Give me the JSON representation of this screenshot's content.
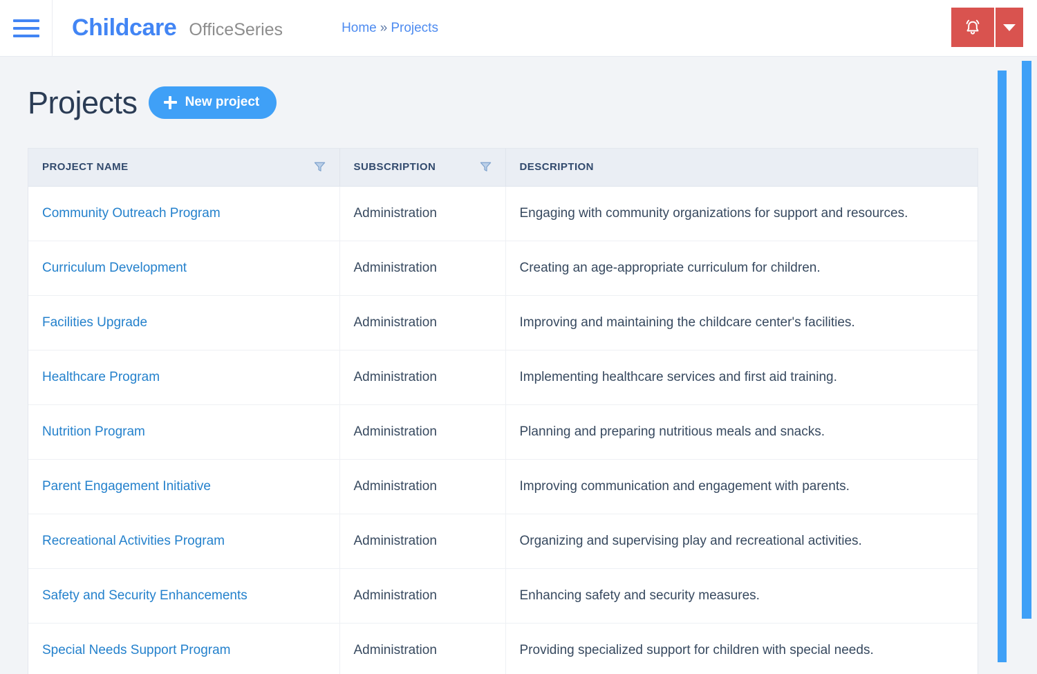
{
  "header": {
    "menu_icon": "hamburger-icon",
    "brand_main": "Childcare",
    "brand_sub": "OfficeSeries",
    "breadcrumb": {
      "home": "Home",
      "separator": "»",
      "current": "Projects"
    },
    "actions": {
      "bell_icon": "bell-icon",
      "caret_icon": "caret-down-icon",
      "accent_color": "#d9534f"
    }
  },
  "page": {
    "title": "Projects",
    "new_button_label": "New project",
    "new_button_icon": "plus-icon",
    "accent_color": "#3fa0f7"
  },
  "table": {
    "columns": [
      {
        "label": "PROJECT NAME",
        "filterable": true,
        "filter_icon": "filter-funnel-icon"
      },
      {
        "label": "SUBSCRIPTION",
        "filterable": true,
        "filter_icon": "filter-funnel-icon"
      },
      {
        "label": "DESCRIPTION",
        "filterable": false,
        "filter_icon": ""
      }
    ],
    "rows": [
      {
        "name": "Community Outreach Program",
        "subscription": "Administration",
        "description": "Engaging with community organizations for support and resources."
      },
      {
        "name": "Curriculum Development",
        "subscription": "Administration",
        "description": "Creating an age-appropriate curriculum for children."
      },
      {
        "name": "Facilities Upgrade",
        "subscription": "Administration",
        "description": "Improving and maintaining the childcare center's facilities."
      },
      {
        "name": "Healthcare Program",
        "subscription": "Administration",
        "description": "Implementing healthcare services and first aid training."
      },
      {
        "name": "Nutrition Program",
        "subscription": "Administration",
        "description": "Planning and preparing nutritious meals and snacks."
      },
      {
        "name": "Parent Engagement Initiative",
        "subscription": "Administration",
        "description": "Improving communication and engagement with parents."
      },
      {
        "name": "Recreational Activities Program",
        "subscription": "Administration",
        "description": "Organizing and supervising play and recreational activities."
      },
      {
        "name": "Safety and Security Enhancements",
        "subscription": "Administration",
        "description": "Enhancing safety and security measures."
      },
      {
        "name": "Special Needs Support Program",
        "subscription": "Administration",
        "description": "Providing specialized support for children with special needs."
      }
    ]
  },
  "scrollbars": {
    "inner_name": "inner-vertical-scrollbar",
    "outer_name": "outer-vertical-scrollbar",
    "color": "#3fa0f7"
  }
}
